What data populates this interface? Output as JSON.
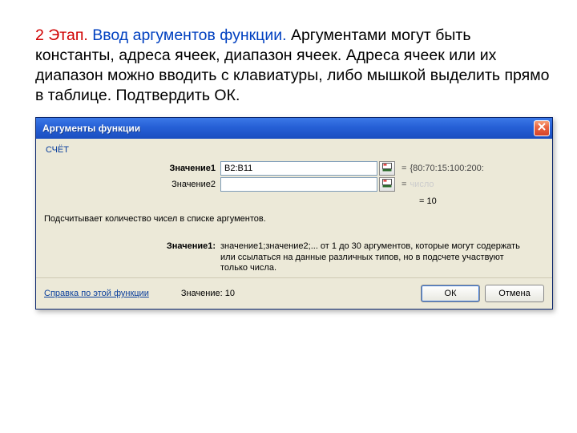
{
  "instruction": {
    "step_label": "2 Этап.",
    "subtitle": "Ввод аргументов функции.",
    "body": " Аргументами могут быть константы, адреса ячеек, диапазон ячеек. Адреса ячеек или их диапазон можно вводить с клавиатуры, либо мышкой выделить прямо в таблице. Подтвердить ОК."
  },
  "dialog": {
    "title": "Аргументы функции",
    "fn_name": "СЧЁТ",
    "args": [
      {
        "label": "Значение1",
        "value": "B2:B11",
        "preview_prefix": "=",
        "preview": "{80:70:15:100:200:",
        "bold": true
      },
      {
        "label": "Значение2",
        "value": "",
        "preview_prefix": "=",
        "preview": "",
        "ghost": "число",
        "bold": false
      }
    ],
    "result_prefix": "=",
    "result": "10",
    "description": "Подсчитывает количество чисел в списке аргументов.",
    "param_name": "Значение1:",
    "param_desc": "значение1;значение2;... от 1 до 30 аргументов, которые могут содержать или ссылаться на данные различных типов, но в подсчете участвуют только числа.",
    "help_link": "Справка по этой функции",
    "footer_label": "Значение:",
    "footer_value": "10",
    "ok": "ОК",
    "cancel": "Отмена"
  }
}
